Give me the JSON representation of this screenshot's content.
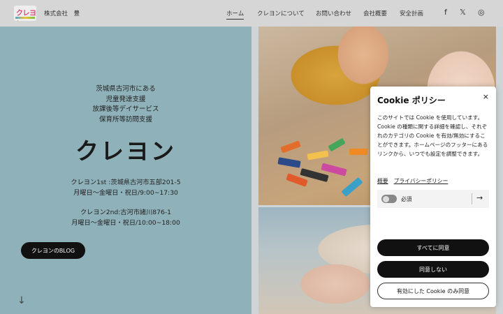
{
  "header": {
    "logo_text": "クレヨン",
    "company": "株式会社　豊",
    "nav": [
      "ホーム",
      "クレヨンについて",
      "お問い合わせ",
      "会社概要",
      "安全計画"
    ],
    "social": {
      "facebook": "f",
      "x": "𝕏",
      "instagram": "◎"
    }
  },
  "hero": {
    "tagline": [
      "茨城県古河市にある",
      "児童発達支援",
      "放課後等デイサービス",
      "保育所等訪問支援"
    ],
    "title": "クレヨン",
    "locations": [
      {
        "name": "クレヨン1st :茨城県古河市五部201-5",
        "hours": "月曜日〜金曜日・祝日/9:00~17:30"
      },
      {
        "name": "クレヨン2nd:古河市諸川876-1",
        "hours": "月曜日〜金曜日・祝日/10:00~18:00"
      }
    ],
    "blog_button": "クレヨンのBLOG",
    "scroll_arrow": "↓"
  },
  "cookie": {
    "title": "Cookie ポリシー",
    "close": "×",
    "description": "このサイトでは Cookie を使用しています。Cookie の種類に関する詳細を確認し、それぞれのカテゴリの Cookie を有効/無効にすることができます。ホームページのフッターにあるリンクから、いつでも設定を調整できます。",
    "links": [
      "概要",
      "プライバシーポリシー"
    ],
    "category": {
      "label": "必須",
      "arrow": "→"
    },
    "buttons": {
      "accept_all": "すべてに同意",
      "reject": "同意しない",
      "accept_selected": "有効にした Cookie のみ同意"
    }
  }
}
